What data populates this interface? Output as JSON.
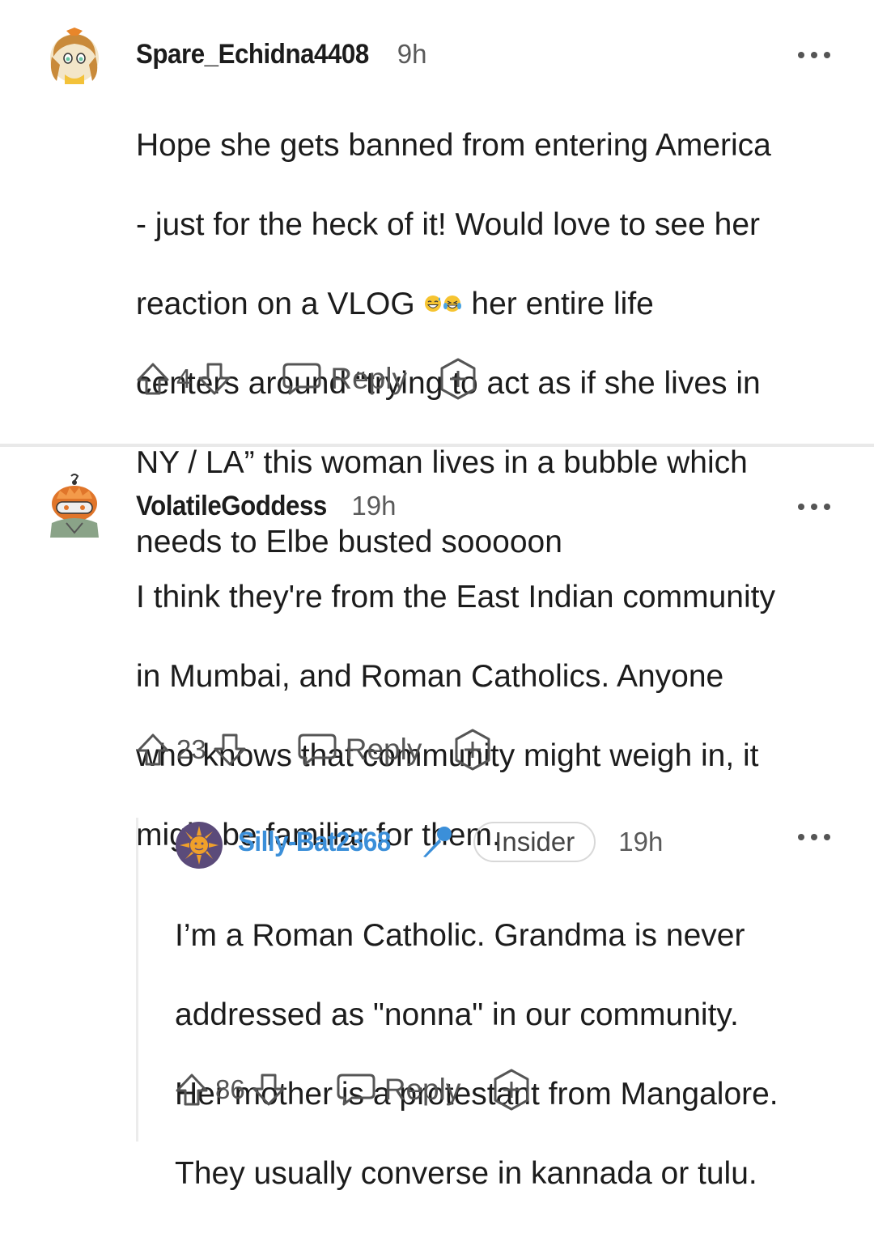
{
  "comments": [
    {
      "username": "Spare_Echidna4408",
      "age": "9h",
      "body_lines": [
        "Hope she gets banned from entering America",
        "- just for the heck of it! Would love to see her",
        "reaction on a VLOG",
        "her entire life",
        "centers around “trying to act as if she lives in",
        "NY / LA” this woman lives in a bubble which",
        "needs to Elbe busted sooooon"
      ],
      "votes": "4",
      "reply_label": "Reply",
      "avatar_icon": "snoo-avatar-icon"
    },
    {
      "username": "VolatileGoddess",
      "age": "19h",
      "body_lines": [
        "I think they're from the East Indian community",
        "in Mumbai, and Roman Catholics. Anyone",
        "who knows that community might weigh in, it",
        "might be familiar for them."
      ],
      "votes": "23",
      "reply_label": "Reply",
      "avatar_icon": "snoo-avatar-icon"
    },
    {
      "username": "Silly-Bat2368",
      "flair": "Insider",
      "age": "19h",
      "body_lines": [
        "I’m a Roman Catholic. Grandma is never",
        "addressed as \"nonna\" in our community.",
        "Her mother is a protestant from Mangalore.",
        "They usually converse in kannada or tulu."
      ],
      "votes": "86",
      "reply_label": "Reply",
      "avatar_icon": "sun-avatar-icon",
      "username_color": "#3b8fd9"
    }
  ],
  "colors": {
    "text": "#1c1c1c",
    "muted": "#555555",
    "link_blue": "#3b8fd9"
  }
}
